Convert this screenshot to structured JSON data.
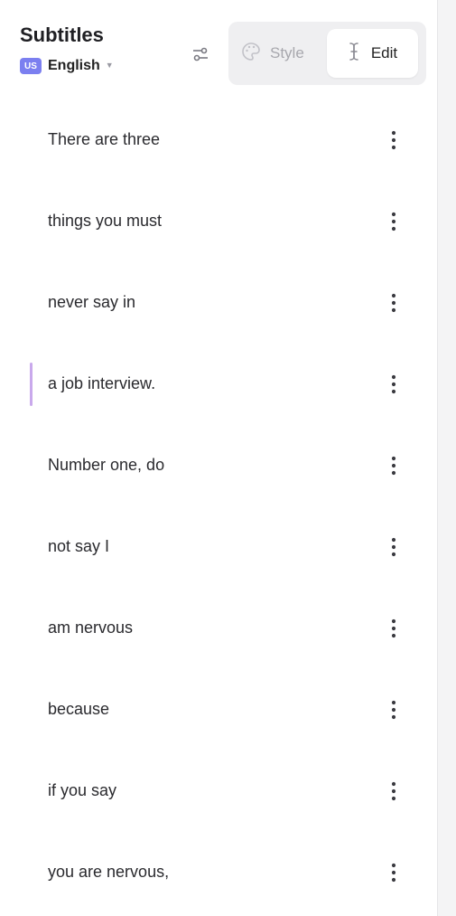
{
  "header": {
    "title": "Subtitles",
    "language": {
      "badge": "US",
      "name": "English"
    },
    "icons": {
      "filter": "sliders-icon",
      "caret": "chevron-down-icon"
    }
  },
  "mode_toggle": {
    "style": {
      "label": "Style",
      "icon": "palette-icon",
      "active": false
    },
    "edit": {
      "label": "Edit",
      "icon": "text-cursor-icon",
      "active": true
    }
  },
  "subtitles": [
    {
      "text": "There are three"
    },
    {
      "text": "things you must"
    },
    {
      "text": "never say in"
    },
    {
      "text": "a job interview.",
      "active": true
    },
    {
      "text": "Number one, do"
    },
    {
      "text": "not say I"
    },
    {
      "text": "am nervous"
    },
    {
      "text": "because"
    },
    {
      "text": "if you say"
    },
    {
      "text": "you are nervous,"
    }
  ],
  "colors": {
    "accent_badge": "#7b7ff0",
    "active_marker": "#c9a9ec",
    "toggle_bg": "#efeff1",
    "muted_text": "#a7a7ad"
  }
}
